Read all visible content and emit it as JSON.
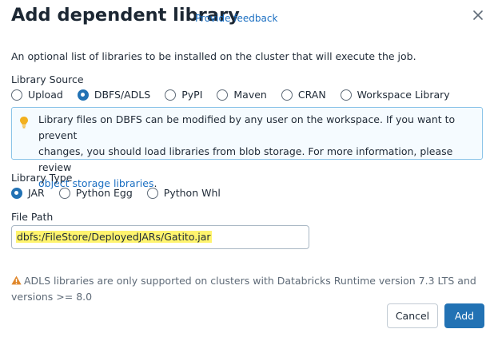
{
  "dialog": {
    "title": "Add dependent library",
    "feedback_link": "Provide feedback",
    "description": "An optional list of libraries to be installed on the cluster that will execute the job."
  },
  "library_source": {
    "label": "Library Source",
    "options": [
      {
        "label": "Upload",
        "selected": false
      },
      {
        "label": "DBFS/ADLS",
        "selected": true
      },
      {
        "label": "PyPI",
        "selected": false
      },
      {
        "label": "Maven",
        "selected": false
      },
      {
        "label": "CRAN",
        "selected": false
      },
      {
        "label": "Workspace Library",
        "selected": false
      }
    ]
  },
  "info_banner": {
    "line1": "Library files on DBFS can be modified by any user on the workspace. If you want to prevent",
    "line2": "changes, you should load libraries from blob storage. For more information, please review",
    "link": "object storage libraries",
    "suffix": ".",
    "icon": "lightbulb-icon",
    "border_color": "#8bc4e8",
    "icon_color": "#f2b01e"
  },
  "library_type": {
    "label": "Library Type",
    "options": [
      {
        "label": "JAR",
        "selected": true
      },
      {
        "label": "Python Egg",
        "selected": false
      },
      {
        "label": "Python Whl",
        "selected": false
      }
    ]
  },
  "file_path": {
    "label": "File Path",
    "value": "dbfs:/FileStore/DeployedJARs/Gatito.jar",
    "highlight_color": "#fff46e"
  },
  "warning": {
    "text": "ADLS libraries are only supported on clusters with Databricks Runtime version 7.3 LTS and versions >= 8.0",
    "icon": "warning-icon",
    "icon_color": "#e0872b"
  },
  "footer": {
    "cancel_label": "Cancel",
    "add_label": "Add"
  },
  "colors": {
    "primary": "#2272b4",
    "link": "#1b6fc2"
  }
}
